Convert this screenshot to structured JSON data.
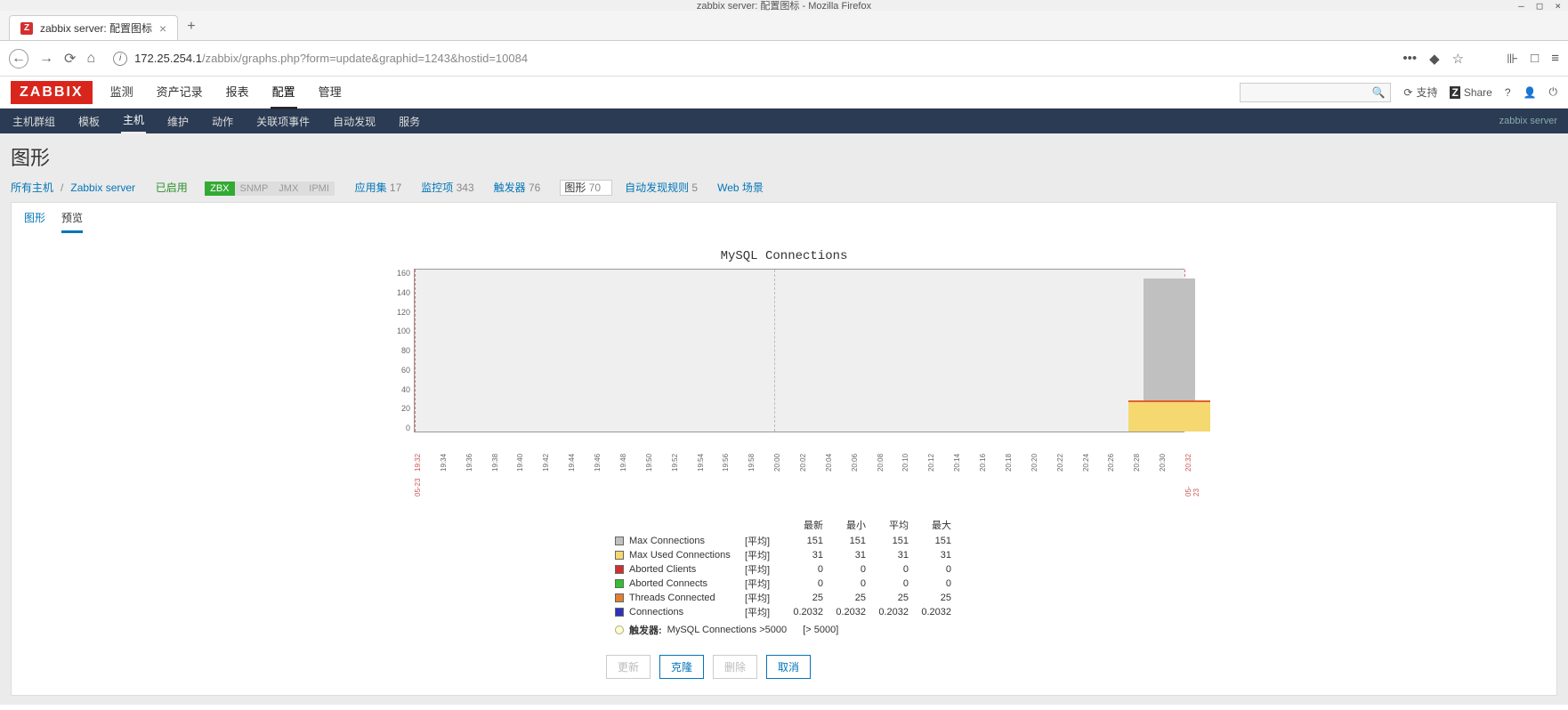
{
  "window": {
    "title": "zabbix server: 配置图标 - Mozilla Firefox",
    "minimize": "—",
    "maximize": "□",
    "close": "×"
  },
  "tab": {
    "title": "zabbix server: 配置图标",
    "close": "×",
    "new": "+"
  },
  "nav": {
    "back": "←",
    "forward": "→",
    "reload": "⟳",
    "home": "⌂"
  },
  "url": {
    "host": "172.25.254.1",
    "path": "/zabbix/graphs.php?form=update&graphid=1243&hostid=10084"
  },
  "url_actions": {
    "more": "•••",
    "reader": "◆",
    "star": "☆",
    "library": "⊪",
    "panel": "□",
    "menu": "≡"
  },
  "mainNav": {
    "logo": "ZABBIX",
    "items": [
      "监测",
      "资产记录",
      "报表",
      "配置",
      "管理"
    ],
    "active": "配置"
  },
  "topRight": {
    "search_icon": "🔍",
    "support": "支持",
    "share": "Share",
    "help": "?",
    "user": "👤",
    "power": "⏻"
  },
  "subNav": {
    "items": [
      "主机群组",
      "模板",
      "主机",
      "维护",
      "动作",
      "关联项事件",
      "自动发现",
      "服务"
    ],
    "active": "主机",
    "right": "zabbix server"
  },
  "pageTitle": "图形",
  "crumbs": {
    "all_hosts": "所有主机",
    "server": "Zabbix server",
    "enabled": "已启用",
    "badges": [
      "ZBX",
      "SNMP",
      "JMX",
      "IPMI"
    ],
    "stats": [
      {
        "label": "应用集",
        "val": "17"
      },
      {
        "label": "监控项",
        "val": "343"
      },
      {
        "label": "触发器",
        "val": "76"
      },
      {
        "label": "图形",
        "val": "70",
        "active": true
      },
      {
        "label": "自动发现规则",
        "val": "5"
      },
      {
        "label": "Web 场景",
        "val": ""
      }
    ]
  },
  "cardTabs": {
    "items": [
      "图形",
      "预览"
    ],
    "active": "预览"
  },
  "chart_data": {
    "type": "bar",
    "title": "MySQL Connections",
    "ylim": [
      0,
      160
    ],
    "yticks": [
      160,
      140,
      120,
      100,
      80,
      60,
      40,
      20,
      0
    ],
    "xticks": [
      "19:32",
      "19:34",
      "19:36",
      "19:38",
      "19:40",
      "19:42",
      "19:44",
      "19:46",
      "19:48",
      "19:50",
      "19:52",
      "19:54",
      "19:56",
      "19:58",
      "20:00",
      "20:02",
      "20:04",
      "20:06",
      "20:08",
      "20:10",
      "20:12",
      "20:14",
      "20:16",
      "20:18",
      "20:20",
      "20:22",
      "20:24",
      "20:26",
      "20:28",
      "20:30",
      "20:32"
    ],
    "xdates": {
      "start": "05-23",
      "end": "05-23"
    },
    "gridlines_at": [
      "20:00"
    ],
    "bars": {
      "max_connections": {
        "x": "20:30",
        "value": 151
      },
      "max_used_connections": {
        "x": "20:30",
        "value": 31
      }
    },
    "legend_headers": [
      "最新",
      "最小",
      "平均",
      "最大"
    ],
    "series": [
      {
        "name": "Max Connections",
        "color": "#c0c0c0",
        "agg": "[平均]",
        "values": [
          151,
          151,
          151,
          151
        ]
      },
      {
        "name": "Max Used Connections",
        "color": "#f5d870",
        "agg": "[平均]",
        "values": [
          31,
          31,
          31,
          31
        ]
      },
      {
        "name": "Aborted Clients",
        "color": "#d03030",
        "agg": "[平均]",
        "values": [
          0,
          0,
          0,
          0
        ]
      },
      {
        "name": "Aborted Connects",
        "color": "#30c030",
        "agg": "[平均]",
        "values": [
          0,
          0,
          0,
          0
        ]
      },
      {
        "name": "Threads Connected",
        "color": "#e08030",
        "agg": "[平均]",
        "values": [
          25,
          25,
          25,
          25
        ]
      },
      {
        "name": "Connections",
        "color": "#3030c0",
        "agg": "[平均]",
        "values": [
          0.2032,
          0.2032,
          0.2032,
          0.2032
        ]
      }
    ],
    "trigger": {
      "label": "触发器:",
      "name": "MySQL Connections >5000",
      "threshold": "[> 5000]"
    }
  },
  "buttons": {
    "update": "更新",
    "clone": "克隆",
    "delete": "删除",
    "cancel": "取消"
  }
}
